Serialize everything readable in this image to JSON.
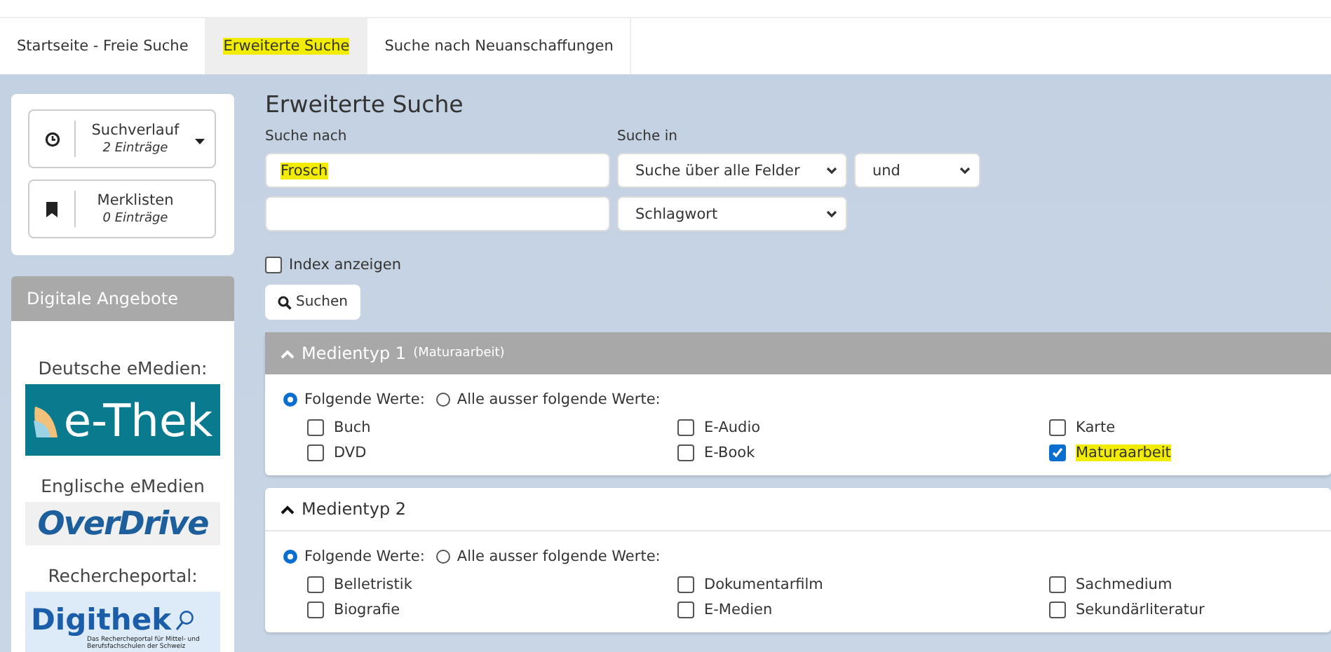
{
  "tabs": [
    {
      "label": "Startseite - Freie Suche",
      "selected": false,
      "highlighted": false
    },
    {
      "label": "Erweiterte Suche",
      "selected": true,
      "highlighted": true
    },
    {
      "label": "Suche nach Neuanschaffungen",
      "selected": false,
      "highlighted": false
    }
  ],
  "sidebar": {
    "widgets": [
      {
        "kind": "history",
        "title": "Suchverlauf",
        "count": "2 Einträge",
        "dropdown": true
      },
      {
        "kind": "bookmark",
        "title": "Merklisten",
        "count": "0 Einträge",
        "dropdown": false
      }
    ],
    "digital": {
      "title": "Digitale Angebote",
      "offers": [
        {
          "caption": "Deutsche eMedien:",
          "kind": "ethek",
          "logo": "e-Thek"
        },
        {
          "caption": "Englische eMedien",
          "kind": "overdrive",
          "logo": "OverDrive"
        },
        {
          "caption": "Rechercheportal:",
          "kind": "digithek",
          "logo": "Digithek",
          "subtitle": "Das Rechercheportal für Mittel- und Berufsfachschulen der Schweiz"
        }
      ]
    }
  },
  "search": {
    "title": "Erweiterte Suche",
    "label_query": "Suche nach",
    "label_field": "Suche in",
    "rows": [
      {
        "value": "Frosch",
        "highlighted": true,
        "field": "Suche über alle Felder",
        "operator": "und"
      },
      {
        "value": "",
        "field": "Schlagwort"
      }
    ],
    "index": {
      "label": "Index anzeigen",
      "checked": false
    },
    "button": "Suchen"
  },
  "facets": [
    {
      "title": "Medientyp 1",
      "note": "(Maturaarbeit)",
      "expanded": true,
      "active": true,
      "modes": [
        {
          "label": "Folgende Werte:",
          "selected": true
        },
        {
          "label": "Alle ausser folgende Werte:",
          "selected": false
        }
      ],
      "options": [
        {
          "label": "Buch",
          "checked": false,
          "highlighted": false
        },
        {
          "label": "E-Audio",
          "checked": false,
          "highlighted": false
        },
        {
          "label": "Karte",
          "checked": false,
          "highlighted": false
        },
        {
          "label": "DVD",
          "checked": false,
          "highlighted": false
        },
        {
          "label": "E-Book",
          "checked": false,
          "highlighted": false
        },
        {
          "label": "Maturaarbeit",
          "checked": true,
          "highlighted": true
        }
      ]
    },
    {
      "title": "Medientyp 2",
      "expanded": true,
      "active": false,
      "modes": [
        {
          "label": "Folgende Werte:",
          "selected": true
        },
        {
          "label": "Alle ausser folgende Werte:",
          "selected": false
        }
      ],
      "options": [
        {
          "label": "Belletristik",
          "checked": false,
          "highlighted": false
        },
        {
          "label": "Dokumentarfilm",
          "checked": false,
          "highlighted": false
        },
        {
          "label": "Sachmedium",
          "checked": false,
          "highlighted": false
        },
        {
          "label": "Biografie",
          "checked": false,
          "highlighted": false
        },
        {
          "label": "E-Medien",
          "checked": false,
          "highlighted": false
        },
        {
          "label": "Sekundärliteratur",
          "checked": false,
          "highlighted": false
        }
      ]
    }
  ]
}
